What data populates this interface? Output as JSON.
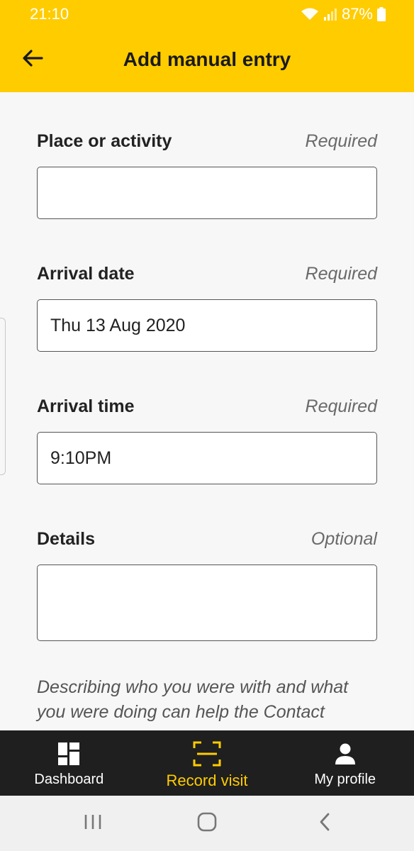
{
  "status_bar": {
    "time": "21:10",
    "battery": "87%",
    "icons": [
      "wifi-icon",
      "signal-icon",
      "battery-icon"
    ]
  },
  "app_bar": {
    "title": "Add manual entry",
    "back_icon": "back-arrow-icon"
  },
  "form": {
    "place": {
      "label": "Place or activity",
      "hint": "Required",
      "value": ""
    },
    "arrival_date": {
      "label": "Arrival date",
      "hint": "Required",
      "value": "Thu 13 Aug 2020"
    },
    "arrival_time": {
      "label": "Arrival time",
      "hint": "Required",
      "value": "9:10PM"
    },
    "details": {
      "label": "Details",
      "hint": "Optional",
      "value": ""
    },
    "help_text": "Describing who you were with and what you were doing can help the Contact"
  },
  "bottom_nav": {
    "items": [
      {
        "label": "Dashboard",
        "icon": "dashboard-icon",
        "active": false
      },
      {
        "label": "Record visit",
        "icon": "scan-icon",
        "active": true
      },
      {
        "label": "My profile",
        "icon": "profile-icon",
        "active": false
      }
    ]
  },
  "system_nav": {
    "icons": [
      "recent-apps-icon",
      "home-icon",
      "system-back-icon"
    ]
  },
  "colors": {
    "accent": "#ffcc00",
    "nav_background": "#1f1f1f",
    "page_background": "#f7f7f7"
  }
}
